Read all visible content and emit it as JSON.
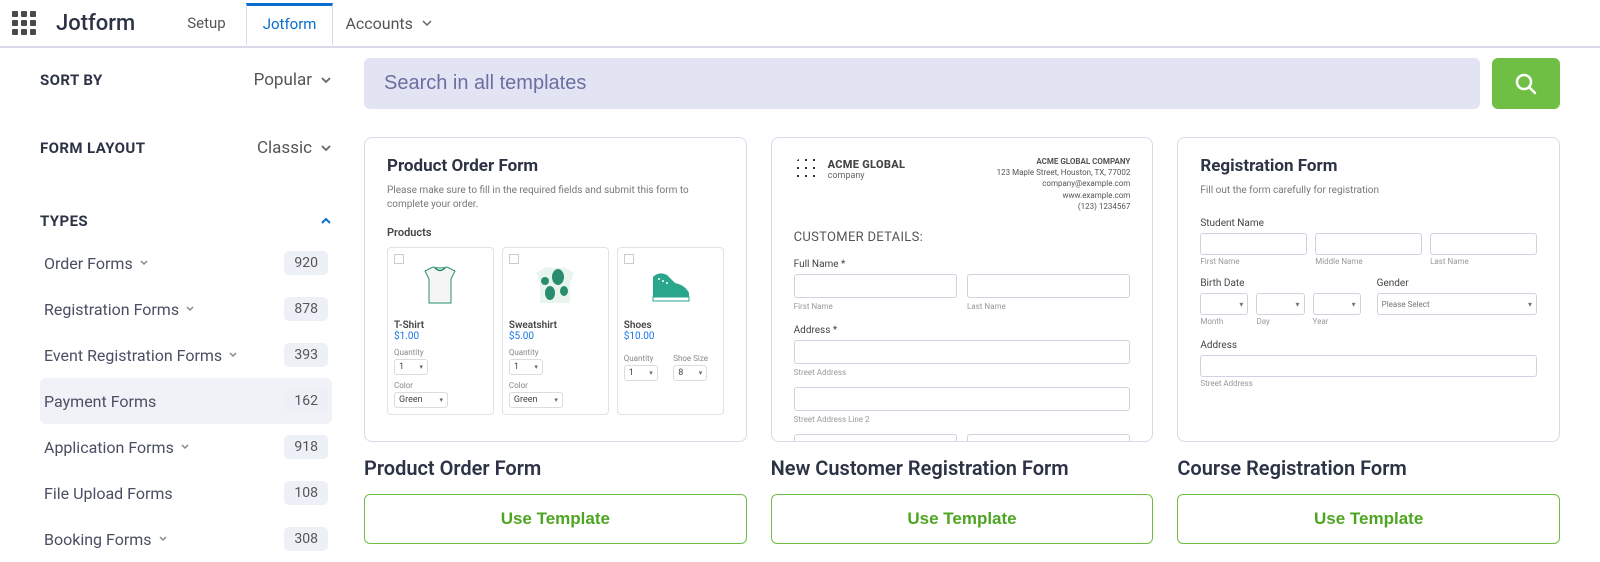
{
  "header": {
    "brand": "Jotform",
    "tabs": {
      "setup": "Setup",
      "jotform": "Jotform",
      "accounts": "Accounts"
    }
  },
  "sidebar": {
    "sort_by_label": "SORT BY",
    "sort_by_value": "Popular",
    "layout_label": "FORM LAYOUT",
    "layout_value": "Classic",
    "types_label": "TYPES",
    "types": [
      {
        "label": "Order Forms",
        "count": "920",
        "expandable": true
      },
      {
        "label": "Registration Forms",
        "count": "878",
        "expandable": true
      },
      {
        "label": "Event Registration Forms",
        "count": "393",
        "expandable": true
      },
      {
        "label": "Payment Forms",
        "count": "162",
        "expandable": false
      },
      {
        "label": "Application Forms",
        "count": "918",
        "expandable": true
      },
      {
        "label": "File Upload Forms",
        "count": "108",
        "expandable": false
      },
      {
        "label": "Booking Forms",
        "count": "308",
        "expandable": true
      }
    ]
  },
  "search": {
    "placeholder": "Search in all templates"
  },
  "cards": [
    {
      "title": "Product Order Form",
      "button": "Use Template",
      "preview": {
        "heading": "Product Order Form",
        "desc": "Please make sure to fill in the required fields and submit this form to complete your order.",
        "section": "Products",
        "products": [
          {
            "name": "T-Shirt",
            "price": "$1.00",
            "qty_label": "Quantity",
            "qty": "1",
            "color_label": "Color",
            "color": "Green"
          },
          {
            "name": "Sweatshirt",
            "price": "$5.00",
            "qty_label": "Quantity",
            "qty": "1",
            "color_label": "Color",
            "color": "Green"
          },
          {
            "name": "Shoes",
            "price": "$10.00",
            "qty_label": "Quantity",
            "qty": "1",
            "size_label": "Shoe Size",
            "size": "8"
          }
        ]
      }
    },
    {
      "title": "New Customer Registration Form",
      "button": "Use Template",
      "preview": {
        "company": "ACME GLOBAL",
        "company_sub": "company",
        "company_title": "ACME GLOBAL COMPANY",
        "addr": "123 Maple Street, Houston, TX, 77002",
        "email": "company@example.com",
        "web": "www.example.com",
        "phone": "(123) 1234567",
        "section": "CUSTOMER DETAILS:",
        "fullname": "Full Name *",
        "first": "First Name",
        "last": "Last Name",
        "address": "Address *",
        "street1": "Street Address",
        "street2": "Street Address Line 2"
      }
    },
    {
      "title": "Course Registration Form",
      "button": "Use Template",
      "preview": {
        "heading": "Registration Form",
        "desc": "Fill out the form carefully for registration",
        "student": "Student Name",
        "first": "First Name",
        "middle": "Middle Name",
        "last": "Last Name",
        "birth": "Birth Date",
        "month": "Month",
        "day": "Day",
        "year": "Year",
        "gender": "Gender",
        "gender_ph": "Please Select",
        "address": "Address",
        "street": "Street Address"
      }
    }
  ]
}
